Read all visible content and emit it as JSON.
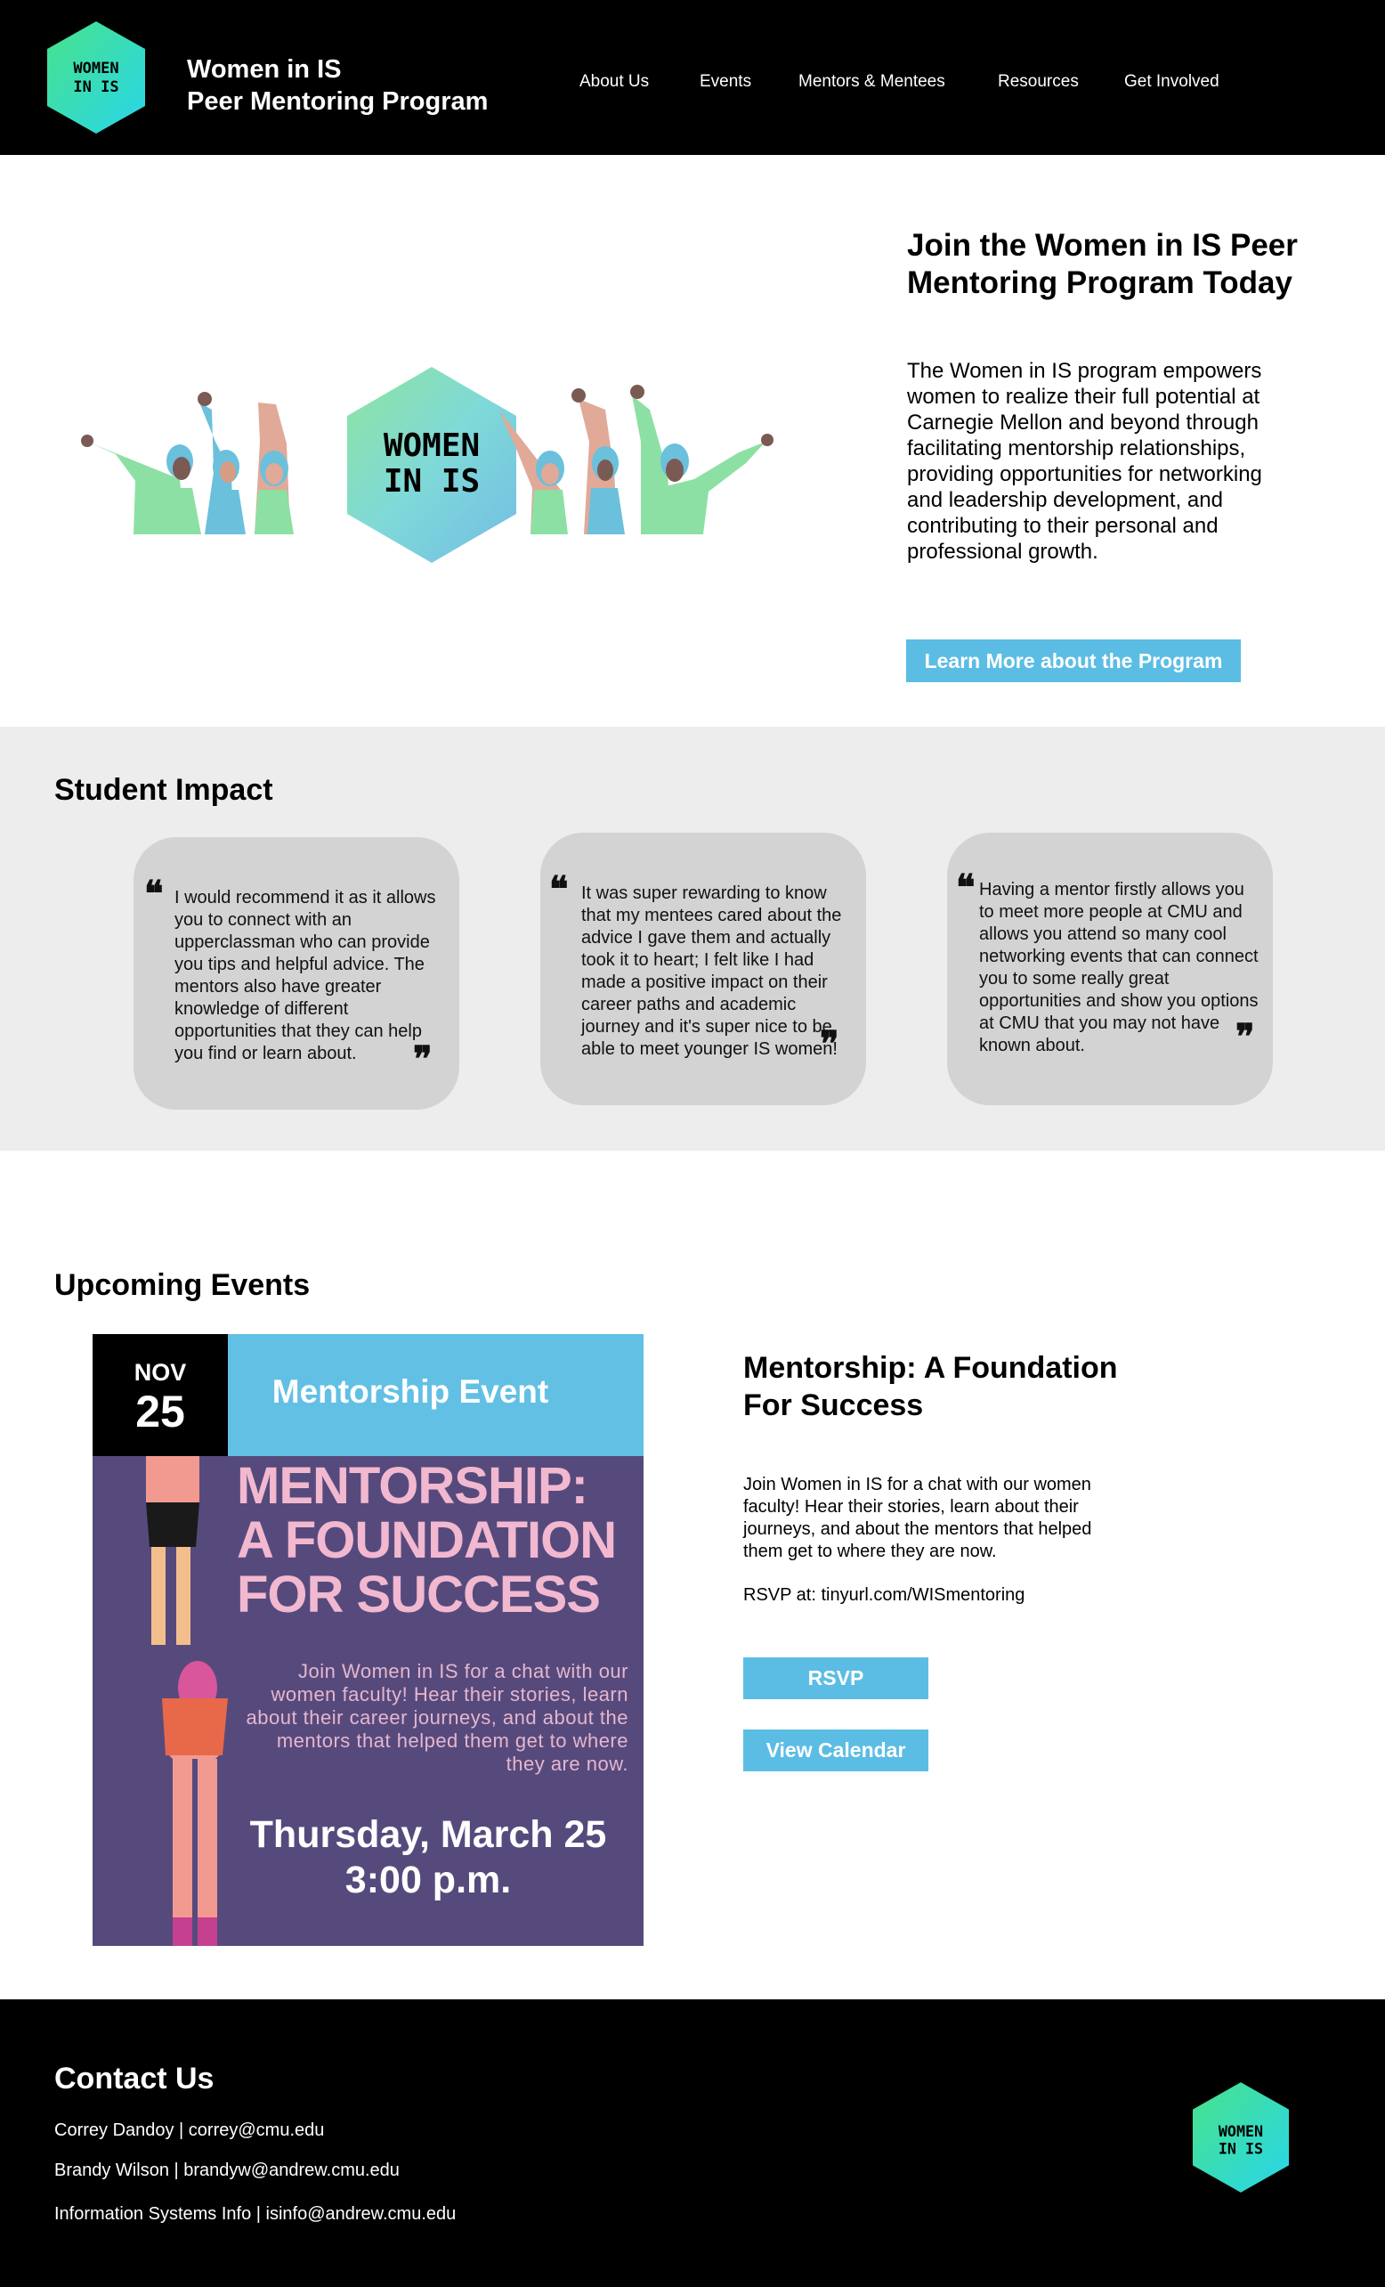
{
  "header": {
    "logo_text": "WOMEN IN IS",
    "title_line1": "Women in IS",
    "title_line2": "Peer Mentoring Program",
    "nav": [
      "About Us",
      "Events",
      "Mentors & Mentees",
      "Resources",
      "Get Involved"
    ]
  },
  "hero": {
    "illustration_text": "WOMEN IN IS",
    "title": "Join the Women in IS Peer Mentoring Program Today",
    "description": "The Women in IS program empowers women to realize their full potential at Carnegie Mellon and beyond through facilitating mentorship relationships, providing opportunities for networking and leadership development, and contributing to their personal and professional growth.",
    "button_label": "Learn More about the Program"
  },
  "impact": {
    "title": "Student Impact",
    "quotes": [
      "I would recommend it as it allows you to connect with an upperclassman who can provide you tips and helpful advice. The mentors also have greater knowledge of different opportunities that they can help you find or learn about.",
      "It was super rewarding to know that my mentees cared about the advice I gave them and actually took it to heart; I felt like I had made a positive impact on their career paths and academic journey and it's super nice to be able to meet younger IS women!",
      "Having a mentor firstly allows you to meet more people at CMU and allows you attend so many cool networking events that can connect you to some really great opportunities and show you options at CMU that you may not have known about."
    ],
    "open_mark": "❝",
    "close_mark": "❞"
  },
  "events": {
    "title": "Upcoming Events",
    "poster": {
      "month": "NOV",
      "day": "25",
      "band_text": "Mentorship Event",
      "headline": "MENTORSHIP: A FOUNDATION FOR SUCCESS",
      "body": "Join Women in IS for a chat with our women faculty! Hear their stories, learn about their career journeys, and about the mentors that helped them get to where they are now.",
      "when_line1": "Thursday, March 25",
      "when_line2": "3:00 p.m."
    },
    "event_title": "Mentorship: A Foundation For Success",
    "event_desc": "Join Women in IS for a chat with our women faculty! Hear their stories, learn about their journeys, and about the mentors that helped them get to where they are now.",
    "rsvp_text": "RSVP at: tinyurl.com/WISmentoring",
    "rsvp_button": "RSVP",
    "calendar_button": "View Calendar"
  },
  "footer": {
    "title": "Contact Us",
    "contacts": [
      "Correy Dandoy | correy@cmu.edu",
      "Brandy Wilson | brandyw@andrew.cmu.edu",
      "Information Systems Info | isinfo@andrew.cmu.edu"
    ],
    "logo_text": "WOMEN IN IS"
  },
  "colors": {
    "accent_blue": "#5cbde4",
    "poster_purple": "#564a7d",
    "logo_green": "#3fe08c",
    "logo_cyan": "#2ad8e6"
  }
}
